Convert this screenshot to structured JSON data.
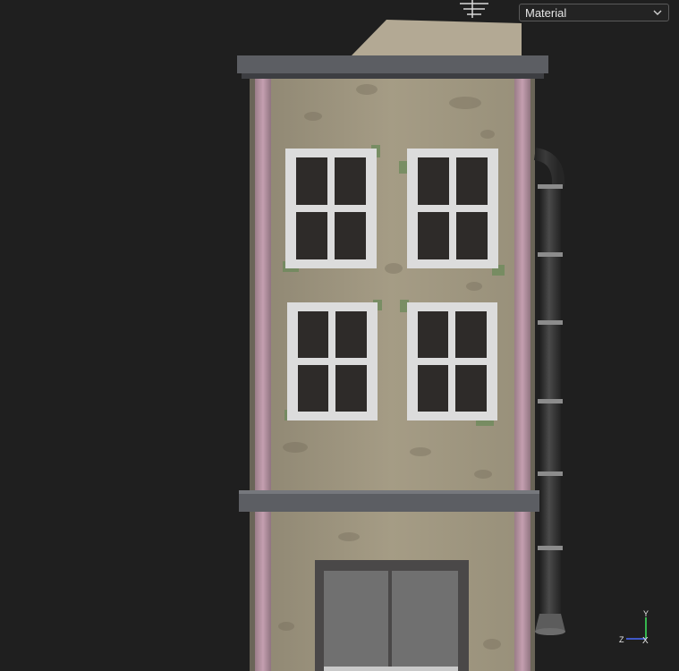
{
  "view_mode": {
    "selected": "Material",
    "icon": "chevron-down-icon"
  },
  "axis_gizmo": {
    "y_label": "Y",
    "z_label": "Z",
    "x_label": "X",
    "y_color": "#3ddc5a",
    "z_color": "#4a6cff",
    "x_color": "#e8e8e8"
  },
  "colors": {
    "background": "#1f1f1f",
    "wall": "#a59c85",
    "trim": "#5c5e63",
    "pink_pillar": "#b892a3",
    "window_frame": "#dcdcdc",
    "window_glass": "#2e2b29",
    "pipe": "#3a3a3a",
    "door": "#707070"
  }
}
